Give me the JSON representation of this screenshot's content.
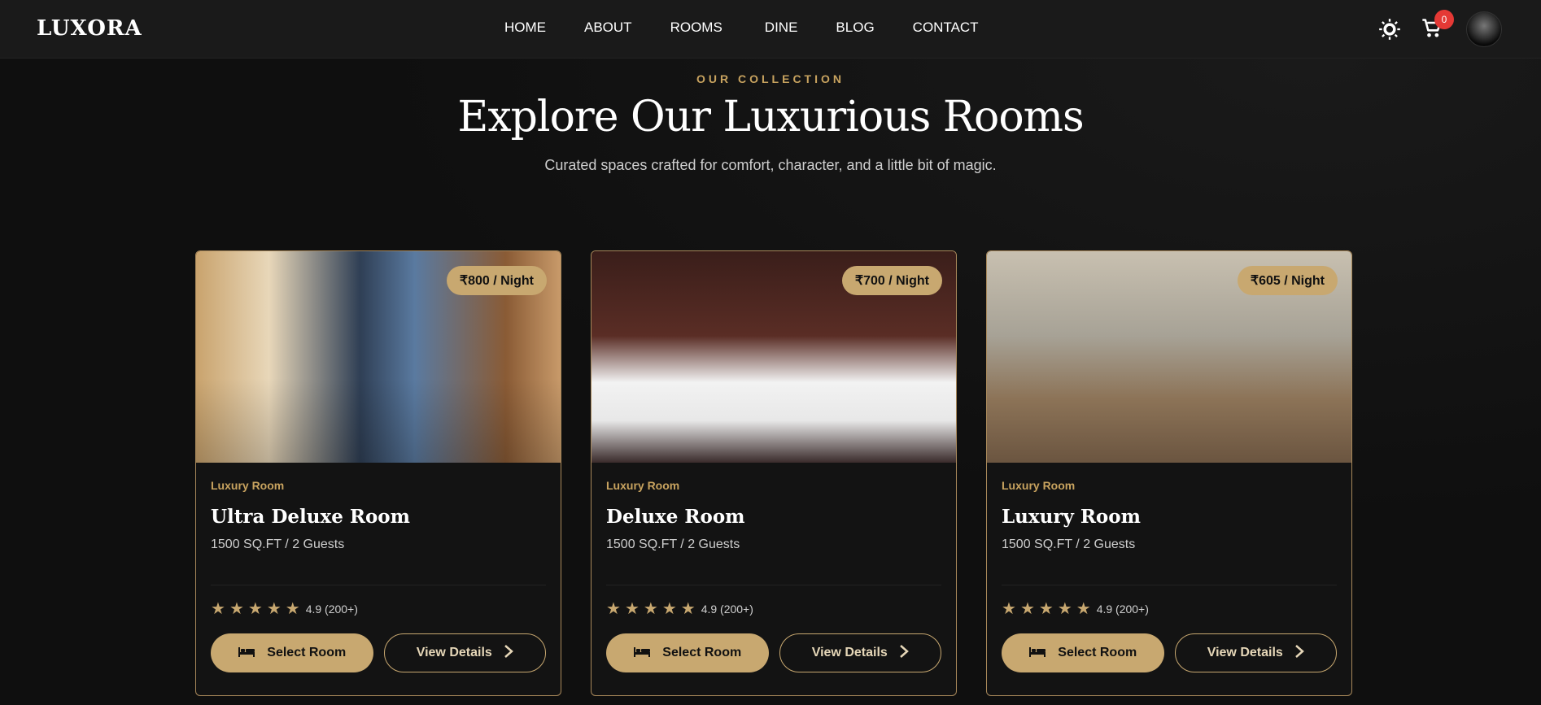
{
  "brand": {
    "logo": "LUXORA"
  },
  "nav": {
    "links": [
      "HOME",
      "ABOUT",
      "ROOMS",
      "DINE",
      "BLOG",
      "CONTACT"
    ],
    "cart_count": "0",
    "icons": [
      "sun-icon",
      "cart-icon",
      "avatar"
    ]
  },
  "hero": {
    "eyebrow": "OUR COLLECTION",
    "title": "Explore Our Luxurious Rooms",
    "subtitle": "Curated spaces crafted for comfort, character, and a little bit of magic."
  },
  "colors": {
    "accent": "#c8a870",
    "background": "#0f0f0f",
    "card": "#131313",
    "badge": "#e53935"
  },
  "cards": [
    {
      "price": "₹800 / Night",
      "category": "Luxury Room",
      "title": "Ultra Deluxe Room",
      "meta": "1500 SQ.FT / 2 Guests",
      "stars": 5,
      "rating": "4.9 (200+)",
      "select_label": "Select Room",
      "view_label": "View Details"
    },
    {
      "price": "₹700 / Night",
      "category": "Luxury Room",
      "title": "Deluxe Room",
      "meta": "1500 SQ.FT / 2 Guests",
      "stars": 5,
      "rating": "4.9 (200+)",
      "select_label": "Select Room",
      "view_label": "View Details"
    },
    {
      "price": "₹605 / Night",
      "category": "Luxury Room",
      "title": "Luxury Room",
      "meta": "1500 SQ.FT / 2 Guests",
      "stars": 5,
      "rating": "4.9 (200+)",
      "select_label": "Select Room",
      "view_label": "View Details"
    }
  ]
}
